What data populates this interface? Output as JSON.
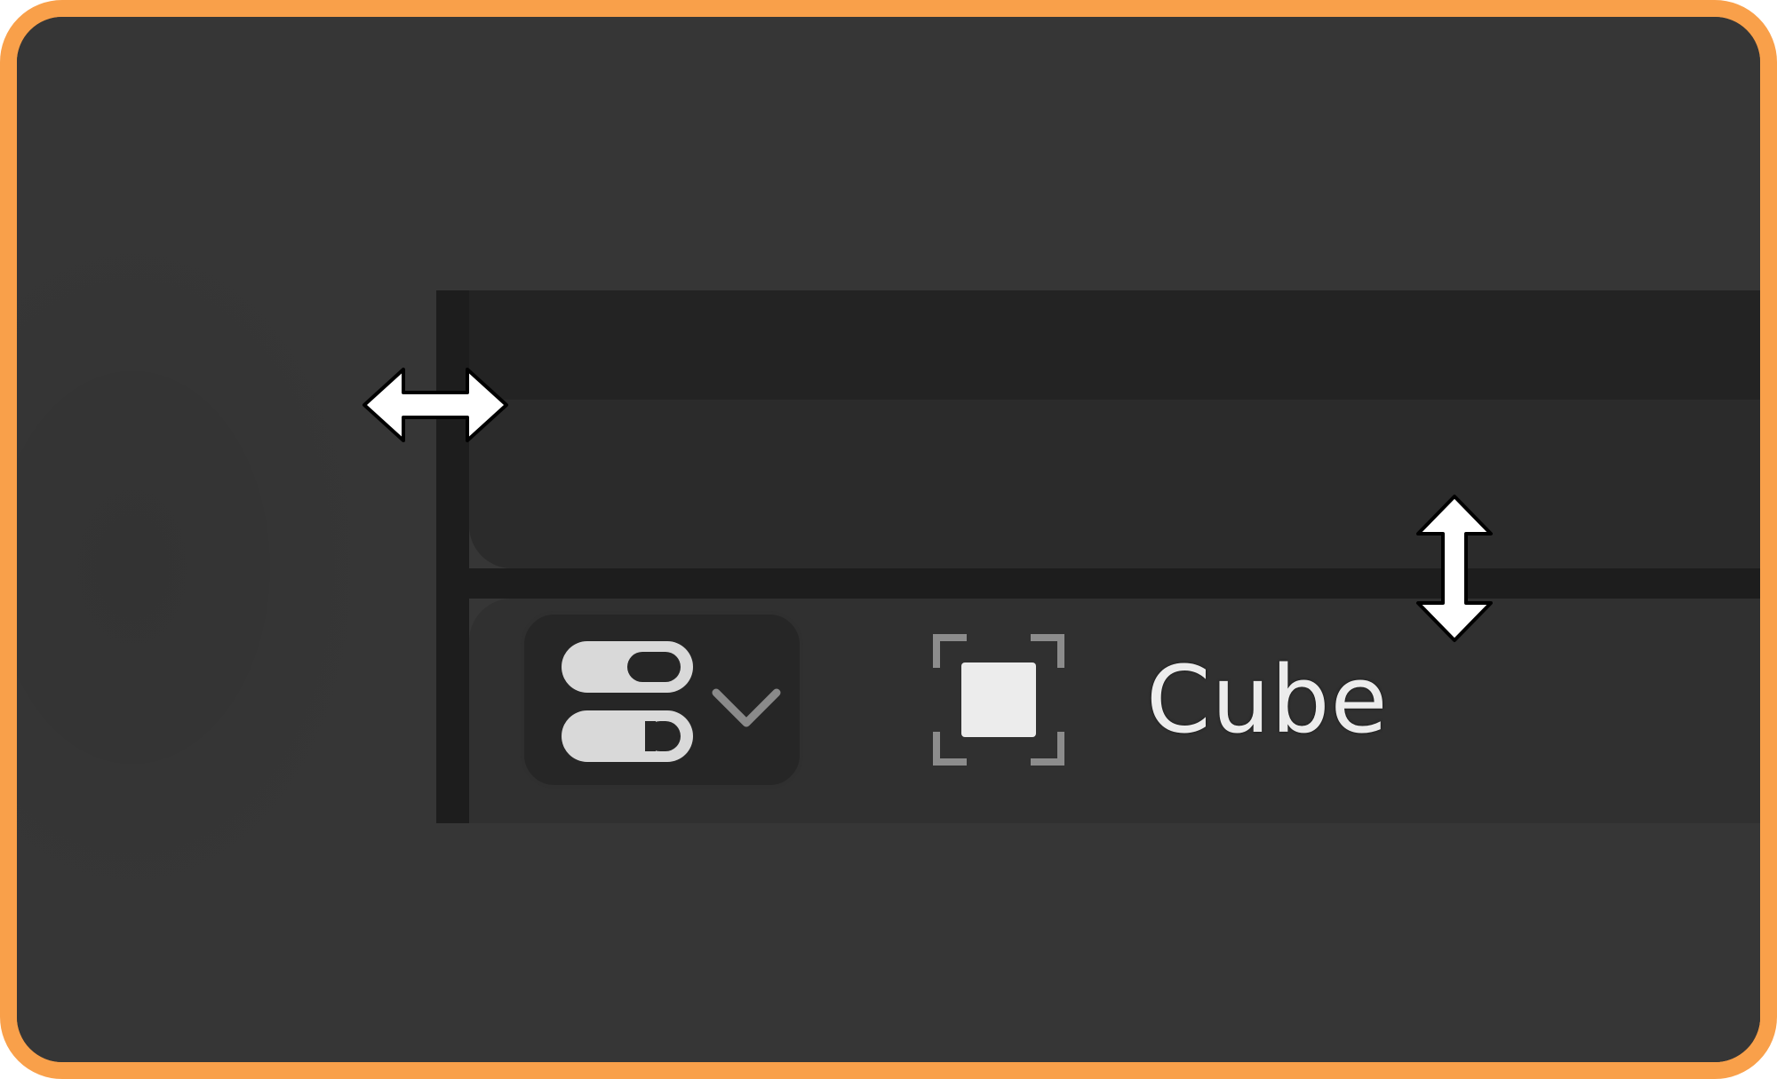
{
  "outliner": {
    "object_name": "Cube"
  },
  "icons": {
    "visibility_toggle": "toggle-switches-icon",
    "dropdown": "chevron-down-icon",
    "object": "object-mesh-icon",
    "cursor_horizontal": "resize-horizontal-cursor",
    "cursor_vertical": "resize-vertical-cursor"
  },
  "colors": {
    "frame_border": "#f9a04a",
    "background": "#363636",
    "header": "#232323",
    "panel": "#2b2b2b",
    "split_bar": "#1d1d1d",
    "text": "#ececec"
  }
}
